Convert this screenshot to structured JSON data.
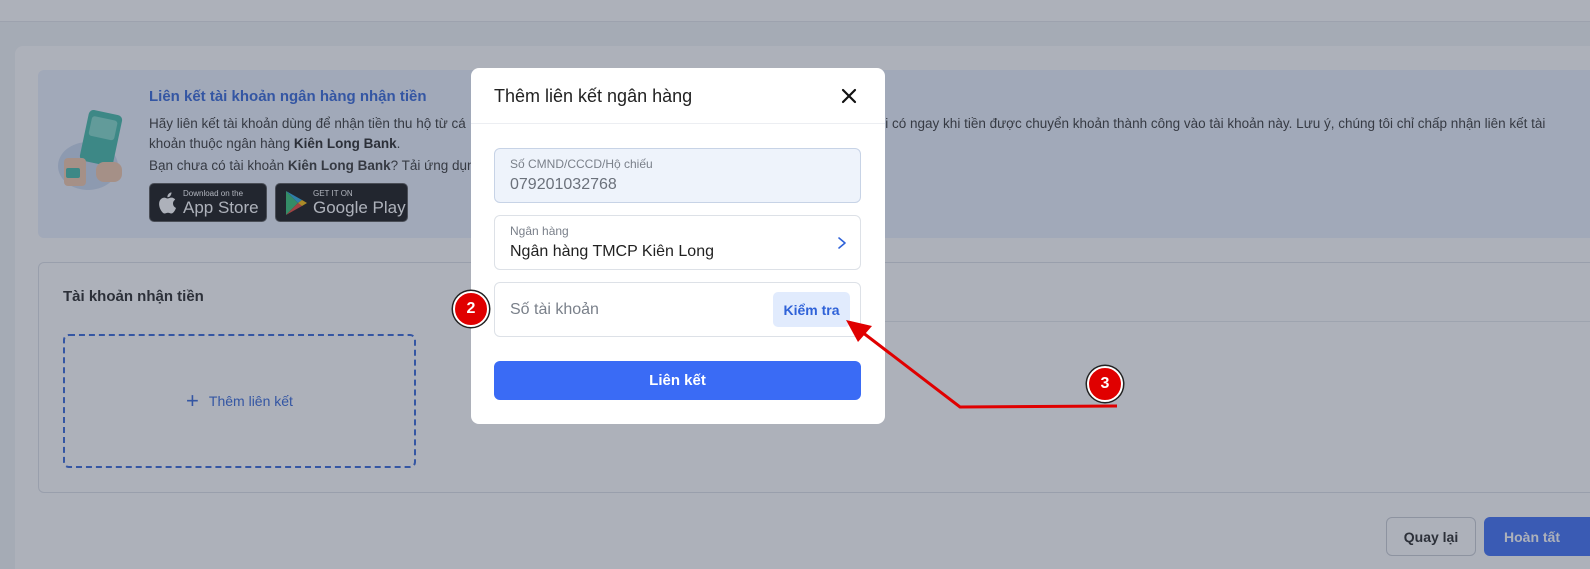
{
  "page": {
    "banner": {
      "title": "Liên kết tài khoản ngân hàng nhận tiền",
      "desc_part1": "Hãy liên kết tài khoản dùng để nhận tiền thu hộ từ cá",
      "desc_part2": "hi có ngay khi tiền được chuyển khoản thành công vào tài khoản này. Lưu ý, chúng tôi chỉ chấp nhận liên kết tài",
      "desc_line2_prefix": "khoản thuộc ngân hàng ",
      "desc_line2_bank": "Kiên Long Bank",
      "desc_line2_suffix": ".",
      "cta_prefix": "Bạn chưa có tài khoản ",
      "cta_bank": "Kiên Long Bank",
      "cta_suffix": "? Tải ứng dụng",
      "app_store_small": "Download on the",
      "app_store_big": "App Store",
      "google_play_small": "GET IT ON",
      "google_play_big": "Google Play"
    },
    "section": {
      "title": "Tài khoản nhận tiền",
      "add_link_label": "Thêm liên kết"
    },
    "footer": {
      "back_label": "Quay lại",
      "done_label": "Hoàn tất"
    }
  },
  "modal": {
    "title": "Thêm liên kết ngân hàng",
    "id_field": {
      "label": "Số CMND/CCCD/Hộ chiếu",
      "value": "079201032768"
    },
    "bank_field": {
      "label": "Ngân hàng",
      "value": "Ngân hàng TMCP Kiên Long"
    },
    "account_field": {
      "placeholder": "Số tài khoản",
      "check_label": "Kiểm tra"
    },
    "submit_label": "Liên kết"
  },
  "annotations": {
    "step_2": "2",
    "step_3": "3"
  },
  "colors": {
    "primary": "#3a6bf5",
    "link": "#2f62d8",
    "annotation": "#e00000"
  }
}
